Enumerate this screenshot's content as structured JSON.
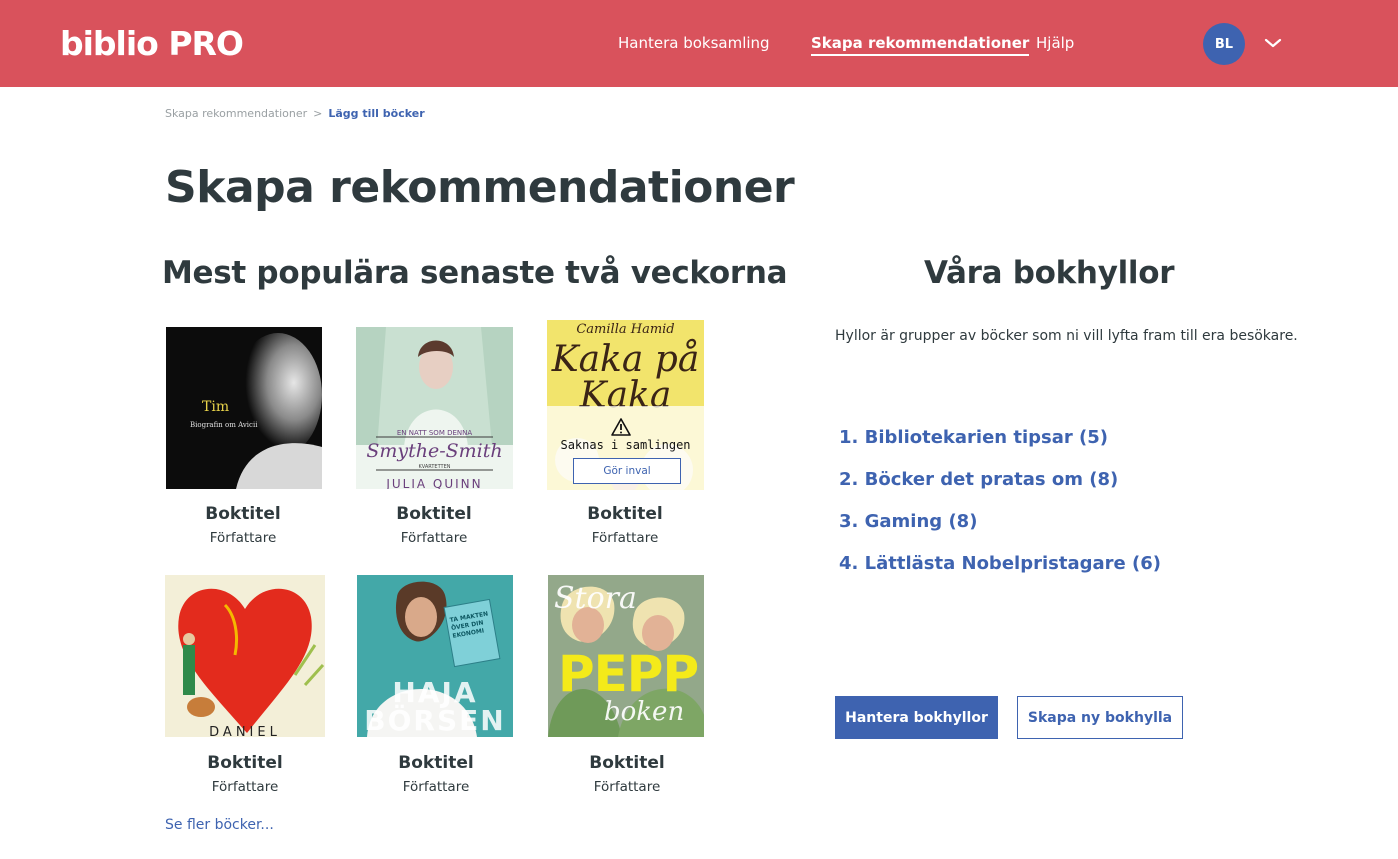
{
  "header": {
    "logo": "biblio PRO",
    "nav": [
      {
        "label": "Hantera boksamling"
      },
      {
        "label": "Skapa rekommendationer"
      },
      {
        "label": "Hjälp"
      }
    ],
    "avatar_initials": "BL",
    "icons": {
      "dropdown": "chevron-down-icon"
    }
  },
  "breadcrumb": {
    "parent": "Skapa rekommendationer",
    "separator": ">",
    "current": "Lägg till böcker"
  },
  "page_title": "Skapa rekommendationer",
  "popular": {
    "heading": "Mest populära senaste två veckorna",
    "books": [
      {
        "title": "Boktitel",
        "author": "Författare",
        "cover_text": [
          "Tim",
          "Biografin om Avicii"
        ]
      },
      {
        "title": "Boktitel",
        "author": "Författare",
        "cover_text": [
          "EN NATT SOM DENNA",
          "Smythe-Smith",
          "KVARTETTEN",
          "JULIA QUINN"
        ]
      },
      {
        "title": "Boktitel",
        "author": "Författare",
        "cover_text": [
          "Camilla Hamid",
          "Kaka på Kaka"
        ],
        "missing_label": "Saknas i samlingen",
        "action_label": "Gör inval"
      },
      {
        "title": "Boktitel",
        "author": "Författare",
        "cover_text": [
          "DANIEL"
        ]
      },
      {
        "title": "Boktitel",
        "author": "Författare",
        "cover_text": [
          "TA MAKTEN ÖVER DIN EKONOMI",
          "HAJA BÖRSEN"
        ]
      },
      {
        "title": "Boktitel",
        "author": "Författare",
        "cover_text": [
          "Stora",
          "PEPP",
          "boken"
        ]
      }
    ],
    "more_link": "Se fler böcker..."
  },
  "shelves": {
    "heading": "Våra bokhyllor",
    "description": "Hyllor är grupper av böcker som ni vill lyfta fram till era besökare.",
    "items": [
      "1. Bibliotekarien tipsar (5)",
      "2. Böcker det pratas om (8)",
      "3. Gaming (8)",
      "4. Lättlästa Nobelpristagare (6)"
    ],
    "manage_button": "Hantera bokhyllor",
    "create_button": "Skapa ny bokhylla"
  },
  "colors": {
    "brand": "#d9525c",
    "accent": "#3e63b0",
    "text": "#2f3a3e"
  }
}
